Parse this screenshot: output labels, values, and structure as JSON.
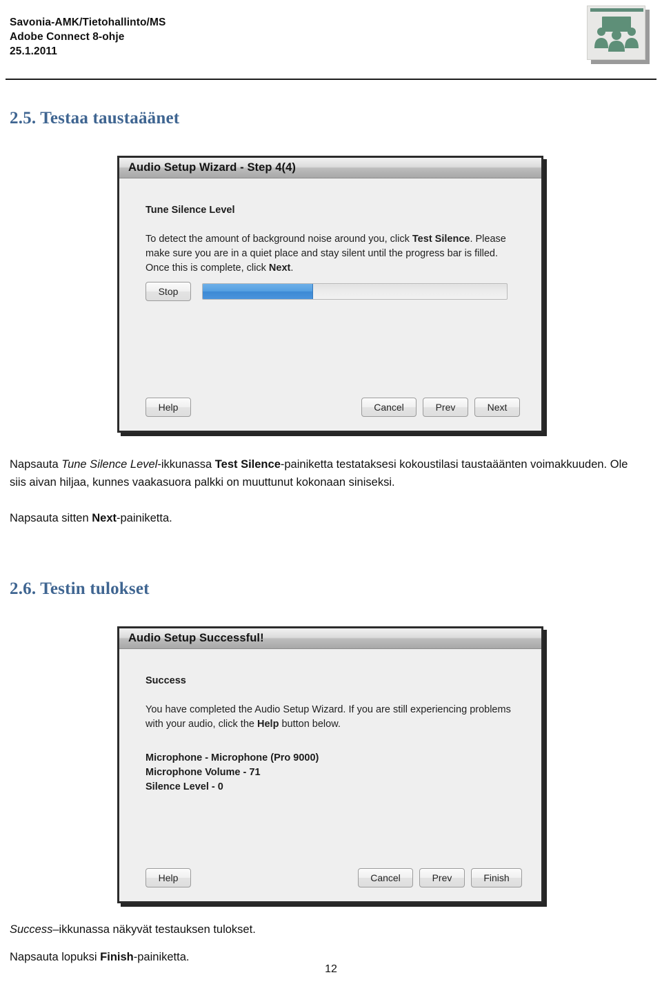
{
  "header": {
    "org_line": "Savonia-AMK/Tietohallinto/MS",
    "doc_line": "Adobe Connect 8-ohje",
    "date_line": "25.1.2011",
    "logo_name": "adobe-connect-meeting-logo"
  },
  "sections": {
    "s25_heading": "2.5. Testaa taustaäänet",
    "s26_heading": "2.6. Testin tulokset"
  },
  "dialog_step4": {
    "title": "Audio Setup Wizard - Step 4(4)",
    "section_label": "Tune Silence Level",
    "paragraph_line1_a": "To detect the amount of background noise around you, click ",
    "paragraph_line1_b": "Test Silence",
    "paragraph_line1_c": ". Please",
    "paragraph_line2": "make sure you are in a quiet place and stay silent until the progress bar is filled.",
    "paragraph_line3_a": "Once this is complete, click ",
    "paragraph_line3_b": "Next",
    "paragraph_line3_c": ".",
    "stop_button": "Stop",
    "progress_percent": 36,
    "progress_fill_color": "#4a93dc",
    "help_button": "Help",
    "cancel_button": "Cancel",
    "prev_button": "Prev",
    "next_button": "Next"
  },
  "dialog_success": {
    "title": "Audio Setup Successful!",
    "section_label": "Success",
    "paragraph_line1": "You have completed the Audio Setup Wizard. If you are still experiencing problems",
    "paragraph_line2_a": "with your audio, click the ",
    "paragraph_line2_b": "Help",
    "paragraph_line2_c": " button below.",
    "result_line1": "Microphone - Microphone (Pro 9000)",
    "result_line2": "Microphone Volume - 71",
    "result_line3": "Silence Level - 0",
    "help_button": "Help",
    "cancel_button": "Cancel",
    "prev_button": "Prev",
    "finish_button": "Finish"
  },
  "body": {
    "p1_a": "Napsauta ",
    "p1_i": "Tune Silence Level",
    "p1_b": "-ikkunassa ",
    "p1_bold": "Test Silence",
    "p1_c": "-painiketta testataksesi kokoustilasi taustaäänten voimakkuuden. Ole siis aivan hiljaa, kunnes vaakasuora palkki on muuttunut kokonaan siniseksi.",
    "p2_a": "Napsauta sitten ",
    "p2_bold": "Next",
    "p2_c": "-painiketta.",
    "p3_i": "Success",
    "p3_a": "–ikkunassa näkyvät testauksen tulokset.",
    "p4_a": "Napsauta lopuksi ",
    "p4_bold": "Finish",
    "p4_c": "-painiketta."
  },
  "footer": {
    "page_number": "12"
  }
}
